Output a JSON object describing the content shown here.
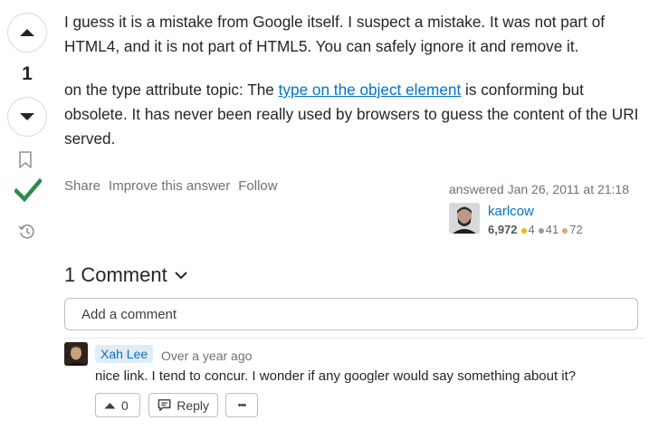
{
  "vote": {
    "count": "1"
  },
  "post": {
    "paragraph1": "I guess it is a mistake from Google itself. I suspect a mistake. It was not part of HTML4, and it is not part of HTML5. You can safely ignore it and remove it.",
    "paragraph2_before": "on the type attribute topic: The ",
    "paragraph2_link": "type on the object element",
    "paragraph2_after": " is conforming but obsolete. It has never been really used by browsers to guess the content of the URI served."
  },
  "actions": {
    "share": "Share",
    "improve": "Improve this answer",
    "follow": "Follow"
  },
  "signature": {
    "answered": "answered Jan 26, 2011 at 21:18",
    "user": "karlcow",
    "reputation": "6,972",
    "gold": "4",
    "silver": "41",
    "bronze": "72",
    "colors": {
      "gold": "#f1b600",
      "silver": "#9a9b9e",
      "bronze": "#d1a684"
    }
  },
  "comments": {
    "title": "1 Comment",
    "add_placeholder": "Add a comment",
    "items": [
      {
        "user": "Xah Lee",
        "time": "Over a year ago",
        "text": "nice link. I tend to concur. I wonder if any googler would say something about it?",
        "upvotes": "0",
        "reply_label": "Reply",
        "more_label": "•••"
      }
    ]
  },
  "colors": {
    "accent_green": "#2f8a4c",
    "link": "#0074cc"
  }
}
